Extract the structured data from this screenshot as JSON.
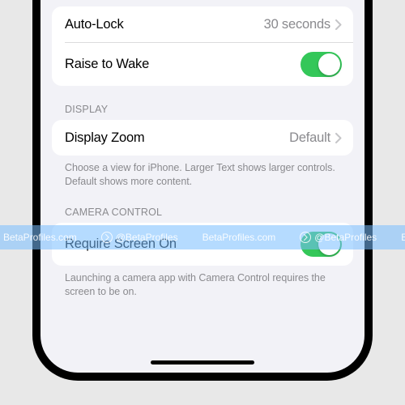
{
  "group1": {
    "autoLock": {
      "label": "Auto-Lock",
      "value": "30 seconds"
    },
    "raiseToWake": {
      "label": "Raise to Wake",
      "on": true
    }
  },
  "displaySection": {
    "header": "DISPLAY",
    "displayZoom": {
      "label": "Display Zoom",
      "value": "Default"
    },
    "footer": "Choose a view for iPhone. Larger Text shows larger controls. Default shows more content."
  },
  "cameraSection": {
    "header": "CAMERA CONTROL",
    "requireScreenOn": {
      "label": "Require Screen On",
      "on": true
    },
    "footer": "Launching a camera app with Camera Control requires the screen to be on."
  },
  "watermark": {
    "text1": "BetaProfiles.com",
    "text2": "@BetaProfiles"
  },
  "colors": {
    "accent": "#34c759"
  }
}
